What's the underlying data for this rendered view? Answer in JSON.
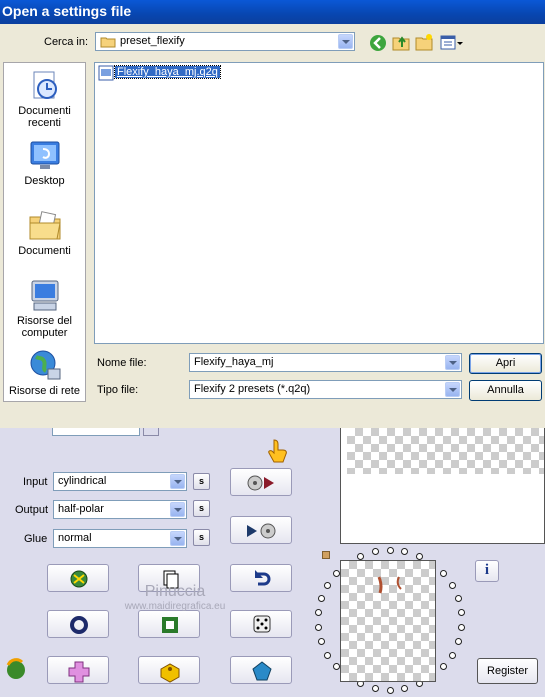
{
  "dialog": {
    "title": "Open a settings file",
    "look_in_label": "Cerca in:",
    "look_in_value": "preset_flexify",
    "places": [
      {
        "label": "Documenti recenti",
        "icon": "recent-documents-icon"
      },
      {
        "label": "Desktop",
        "icon": "desktop-icon"
      },
      {
        "label": "Documenti",
        "icon": "my-documents-icon"
      },
      {
        "label": "Risorse del computer",
        "icon": "my-computer-icon"
      },
      {
        "label": "Risorse di rete",
        "icon": "network-places-icon"
      }
    ],
    "files": [
      {
        "name": "Flexify_haya_mj.q2q",
        "selected": true
      }
    ],
    "filename_label": "Nome file:",
    "filename_value": "Flexify_haya_mj",
    "filetype_label": "Tipo file:",
    "filetype_value": "Flexify 2 presets (*.q2q)",
    "open_button": "Apri",
    "cancel_button": "Annulla"
  },
  "plugin": {
    "input_label": "Input",
    "input_value": "cylindrical",
    "output_label": "Output",
    "output_value": "half-polar",
    "glue_label": "Glue",
    "glue_value": "normal",
    "s_label": "s",
    "info_label": "i",
    "register_button": "Register",
    "watermark_line1": "Pinuccia",
    "watermark_line2": "www.maidiregrafica.eu"
  },
  "colors": {
    "titlebar": "#0a58d6",
    "dialog_bg": "#ece9d8",
    "plugin_bg": "#dcdcec",
    "selection": "#316ac5"
  }
}
